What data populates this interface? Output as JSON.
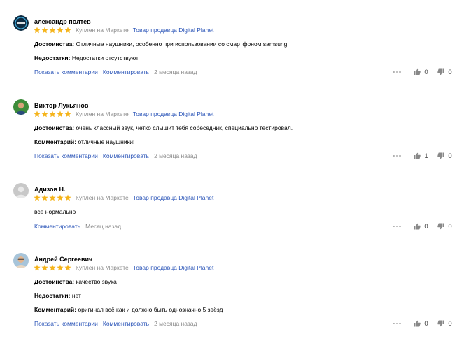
{
  "colors": {
    "star": "#f5b41b",
    "link": "#2b55b8",
    "muted": "#8a8a8a",
    "thumb": "#888888"
  },
  "labels": {
    "bought": "Куплен на Маркете",
    "show_comments": "Показать комментарии",
    "comment": "Комментировать"
  },
  "reviews": [
    {
      "author": "александр полтев",
      "avatar": "brand-logo-avatar",
      "rating": 5,
      "seller": "Товар продавца Digital Planet",
      "fields": [
        {
          "label": "Достоинства:",
          "text": "Отличные наушники, особенно при использовании со смартфоном samsung"
        },
        {
          "label": "Недостатки:",
          "text": "Недостатки отсутствуют"
        }
      ],
      "date": "2 месяца назад",
      "likes": "0",
      "dislikes": "0"
    },
    {
      "author": "Виктор Лукьянов",
      "avatar": "photo-avatar",
      "rating": 5,
      "seller": "Товар продавца Digital Planet",
      "fields": [
        {
          "label": "Достоинства:",
          "text": "очень классный звук, четко слышит тебя собеседник, специально тестировал."
        },
        {
          "label": "Комментарий:",
          "text": "отличные наушники!"
        }
      ],
      "date": "2 месяца назад",
      "likes": "1",
      "dislikes": "0"
    },
    {
      "author": "Адизов Н.",
      "avatar": "default-user-avatar",
      "rating": 5,
      "seller": "Товар продавца Digital Planet",
      "text": "все нормально",
      "date": "Месяц назад",
      "likes": "0",
      "dislikes": "0"
    },
    {
      "author": "Андрей Сергеевич",
      "avatar": "photo-avatar",
      "rating": 5,
      "seller": "Товар продавца Digital Planet",
      "fields": [
        {
          "label": "Достоинства:",
          "text": "качество звука"
        },
        {
          "label": "Недостатки:",
          "text": "нет"
        },
        {
          "label": "Комментарий:",
          "text": "оригинал всё как и должно быть однозначно 5 звёзд"
        }
      ],
      "date": "2 месяца назад",
      "likes": "0",
      "dislikes": "0"
    }
  ]
}
